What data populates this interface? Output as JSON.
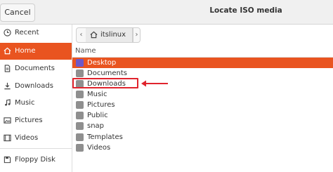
{
  "header": {
    "cancel_label": "Cancel",
    "title": "Locate ISO media"
  },
  "sidebar": {
    "items": [
      {
        "label": "Recent",
        "icon": "clock-icon"
      },
      {
        "label": "Home",
        "icon": "home-icon",
        "active": true
      },
      {
        "label": "Documents",
        "icon": "document-icon"
      },
      {
        "label": "Downloads",
        "icon": "download-icon"
      },
      {
        "label": "Music",
        "icon": "music-icon"
      },
      {
        "label": "Pictures",
        "icon": "picture-icon"
      },
      {
        "label": "Videos",
        "icon": "video-icon"
      },
      {
        "label": "Floppy Disk",
        "icon": "floppy-disk-icon"
      }
    ]
  },
  "path_bar": {
    "current": "itslinux",
    "back_glyph": "‹",
    "forward_glyph": "›"
  },
  "file_list": {
    "column_name": "Name",
    "rows": [
      {
        "label": "Desktop",
        "selected": true
      },
      {
        "label": "Documents"
      },
      {
        "label": "Downloads",
        "highlighted": true
      },
      {
        "label": "Music"
      },
      {
        "label": "Pictures"
      },
      {
        "label": "Public"
      },
      {
        "label": "snap"
      },
      {
        "label": "Templates"
      },
      {
        "label": "Videos"
      }
    ]
  },
  "colors": {
    "accent": "#e95420",
    "annotation": "#e0242d"
  }
}
